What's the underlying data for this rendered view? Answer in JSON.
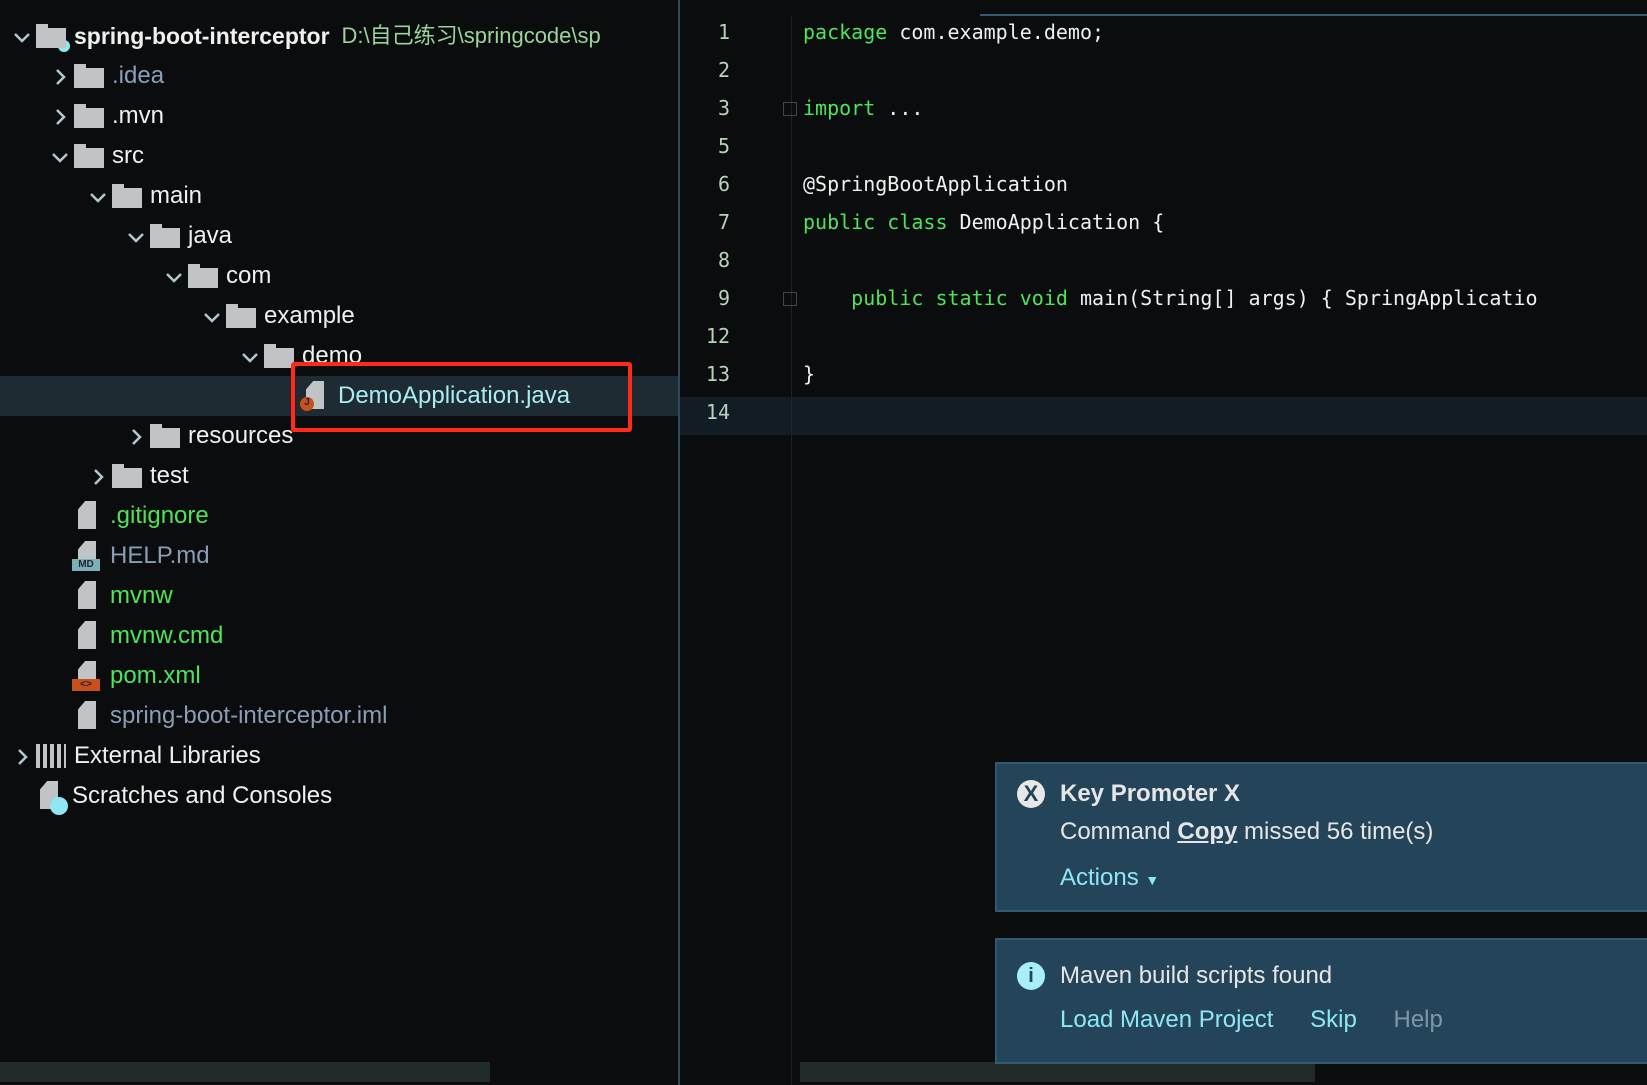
{
  "project_tree": {
    "root": {
      "label": "spring-boot-interceptor",
      "path": "D:\\自己练习\\springcode\\sp"
    },
    "items": [
      {
        "label": ".idea",
        "type": "folder",
        "color": "#8aa0b8"
      },
      {
        "label": ".mvn",
        "type": "folder"
      },
      {
        "label": "src",
        "type": "folder"
      },
      {
        "label": "main",
        "type": "folder"
      },
      {
        "label": "java",
        "type": "folder"
      },
      {
        "label": "com",
        "type": "folder"
      },
      {
        "label": "example",
        "type": "folder"
      },
      {
        "label": "demo",
        "type": "folder"
      },
      {
        "label": "DemoApplication.java",
        "type": "java-file",
        "selected": true
      },
      {
        "label": "resources",
        "type": "folder"
      },
      {
        "label": "test",
        "type": "folder"
      },
      {
        "label": ".gitignore",
        "type": "file",
        "color": "#4ee45a"
      },
      {
        "label": "HELP.md",
        "type": "file",
        "color": "#8a9db5"
      },
      {
        "label": "mvnw",
        "type": "file",
        "color": "#4ee45a"
      },
      {
        "label": "mvnw.cmd",
        "type": "file",
        "color": "#4ee45a"
      },
      {
        "label": "pom.xml",
        "type": "file",
        "color": "#4ee45a"
      },
      {
        "label": "spring-boot-interceptor.iml",
        "type": "file",
        "color": "#8a9db5"
      },
      {
        "label": "External Libraries",
        "type": "libraries"
      },
      {
        "label": "Scratches and Consoles",
        "type": "scratches"
      }
    ]
  },
  "editor": {
    "lines": [
      {
        "n": "1",
        "kw": "package",
        "text": " com.example.demo;"
      },
      {
        "n": "2",
        "kw": "",
        "text": ""
      },
      {
        "n": "3",
        "kw": "import",
        "text": " ..."
      },
      {
        "n": "5",
        "kw": "",
        "text": ""
      },
      {
        "n": "6",
        "kw": "",
        "text": "@SpringBootApplication"
      },
      {
        "n": "7",
        "kw": "public class",
        "text": " DemoApplication {"
      },
      {
        "n": "8",
        "kw": "",
        "text": ""
      },
      {
        "n": "9",
        "kw": "    public static void",
        "text": " main(String[] args) { SpringApplicatio"
      },
      {
        "n": "12",
        "kw": "",
        "text": ""
      },
      {
        "n": "13",
        "kw": "",
        "text": "}"
      },
      {
        "n": "14",
        "kw": "",
        "text": ""
      }
    ]
  },
  "notifications": {
    "key_promoter": {
      "title": "Key Promoter X",
      "msg_pre": "Command ",
      "command": "Copy",
      "msg_post": " missed 56 time(s)",
      "actions": "Actions"
    },
    "maven": {
      "title": "Maven build scripts found",
      "load": "Load Maven Project",
      "skip": "Skip",
      "help": "Help"
    }
  },
  "colors": {
    "accent": "#2e5a72",
    "vcs_added": "#4ee45a",
    "highlight": "#ff2a1a",
    "notification_bg": "#24445a"
  }
}
